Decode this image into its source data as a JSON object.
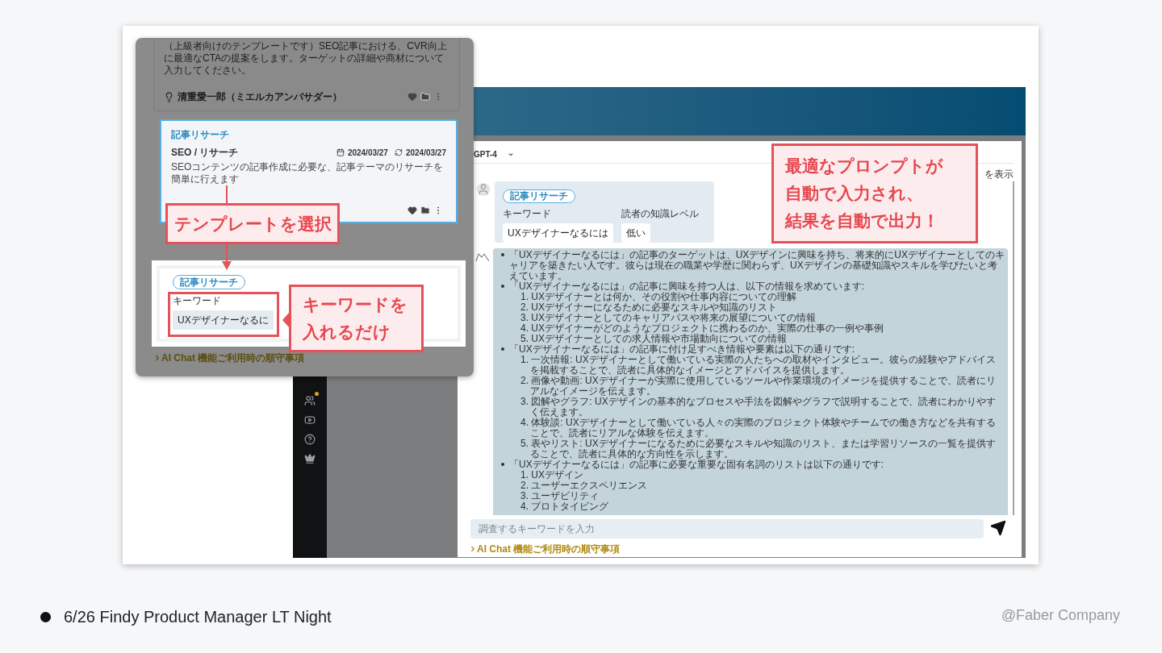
{
  "app": {
    "model_select": {
      "value": "GPT-4"
    },
    "header_link": "を表示",
    "request": {
      "template": "記事リサーチ",
      "fields": [
        {
          "label": "キーワード",
          "value": "UXデザイナーなるには"
        },
        {
          "label": "読者の知識レベル",
          "value": "低い"
        }
      ]
    },
    "answer": [
      {
        "text": "「UXデザイナーなるには」の記事のターゲットは、UXデザインに興味を持ち、将来的にUXデザイナーとしてのキャリアを築きたい人です。彼らは現在の職業や学歴に関わらず、UXデザインの基礎知識やスキルを学びたいと考えています。"
      },
      {
        "text": "「UXデザイナーなるには」の記事に興味を持つ人は、以下の情報を求めています:",
        "children": [
          "1. UXデザイナーとは何か、その役割や仕事内容についての理解",
          "2. UXデザイナーになるために必要なスキルや知識のリスト",
          "3. UXデザイナーとしてのキャリアパスや将来の展望についての情報",
          "4. UXデザイナーがどのようなプロジェクトに携わるのか、実際の仕事の一例や事例",
          "5. UXデザイナーとしての求人情報や市場動向についての情報"
        ]
      },
      {
        "text": "「UXデザイナーなるには」の記事に付け足すべき情報や要素は以下の通りです:",
        "children": [
          "1. 一次情報: UXデザイナーとして働いている実際の人たちへの取材やインタビュー。彼らの経験やアドバイスを掲載することで、読者に具体的なイメージとアドバイスを提供します。",
          "2. 画像や動画: UXデザイナーが実際に使用しているツールや作業環境のイメージを提供することで、読者にリアルなイメージを伝えます。",
          "3. 図解やグラフ: UXデザインの基本的なプロセスや手法を図解やグラフで説明することで、読者にわかりやすく伝えます。",
          "4. 体験談: UXデザイナーとして働いている人々の実際のプロジェクト体験やチームでの働き方などを共有することで、読者にリアルな体験を伝えます。",
          "5. 表やリスト: UXデザイナーになるために必要なスキルや知識のリスト、または学習リソースの一覧を提供することで、読者に具体的な方向性を示します。"
        ]
      },
      {
        "text": "「UXデザイナーなるには」の記事に必要な重要な固有名詞のリストは以下の通りです:",
        "children": [
          "1. UXデザイン",
          "2. ユーザーエクスペリエンス",
          "3. ユーザビリティ",
          "4. プロトタイピング"
        ]
      }
    ],
    "input": {
      "placeholder": "調査するキーワードを入力"
    },
    "notice_link": "AI Chat 機能ご利用時の順守事項"
  },
  "template_popup": {
    "cards": [
      {
        "kind": "partial",
        "description": "（上級者向けのテンプレートです）SEO記事における、CVR向上に最適なCTAの提案をします。ターゲットの詳細や商材について入力してください。",
        "author": "清重愛一郎（ミエルカアンバサダー）",
        "selected": false
      },
      {
        "kind": "full",
        "title": "記事リサーチ",
        "category": "SEO / リサーチ",
        "created": "2024/03/27",
        "updated": "2024/03/27",
        "description": "SEOコンテンツの記事作成に必要な、記事テーマのリサーチを簡単に行えます",
        "selected": true
      }
    ],
    "form": {
      "template": "記事リサーチ",
      "label": "キーワード",
      "value": "UXデザイナーなるに"
    },
    "notice_link": "AI Chat 機能ご利用時の順守事項"
  },
  "callouts": [
    {
      "lines": [
        "テンプレートを選択"
      ]
    },
    {
      "lines": [
        "キーワードを",
        "入れるだけ"
      ]
    },
    {
      "lines": [
        "最適なプロンプトが",
        "自動で入力され、",
        "結果を自動で出力！"
      ]
    }
  ],
  "footer": {
    "title": "6/26 Findy Product Manager LT Night",
    "credit": "@Faber Company"
  }
}
